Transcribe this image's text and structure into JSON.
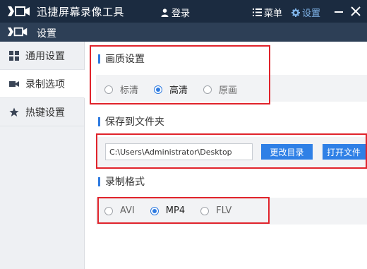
{
  "titlebar": {
    "app_title": "迅捷屏幕录像工具",
    "login_label": "登录",
    "menu_label": "菜单",
    "settings_label": "设置",
    "icons": [
      "camera-logo-icon",
      "user-icon",
      "menu-list-icon",
      "gear-icon",
      "minimize-icon",
      "close-icon"
    ]
  },
  "subbar": {
    "title": "设置"
  },
  "sidebar": {
    "items": [
      {
        "label": "通用设置",
        "icon": "grid-icon"
      },
      {
        "label": "录制选项",
        "icon": "video-camera-icon"
      },
      {
        "label": "热键设置",
        "icon": "star-icon"
      }
    ],
    "active_index": 1
  },
  "quality": {
    "title": "画质设置",
    "options": [
      "标清",
      "高清",
      "原画"
    ],
    "selected": "高清"
  },
  "save_folder": {
    "title": "保存到文件夹",
    "path": "C:\\Users\\Administrator\\Desktop",
    "change_button": "更改目录",
    "open_button": "打开文件"
  },
  "format": {
    "title": "录制格式",
    "options": [
      "AVI",
      "MP4",
      "FLV"
    ],
    "selected": "MP4"
  },
  "colors": {
    "titlebar_bg": "#1b2b40",
    "subbar_bg": "#2d3f56",
    "accent": "#2f7be0",
    "highlight_frame": "#e0232b"
  }
}
